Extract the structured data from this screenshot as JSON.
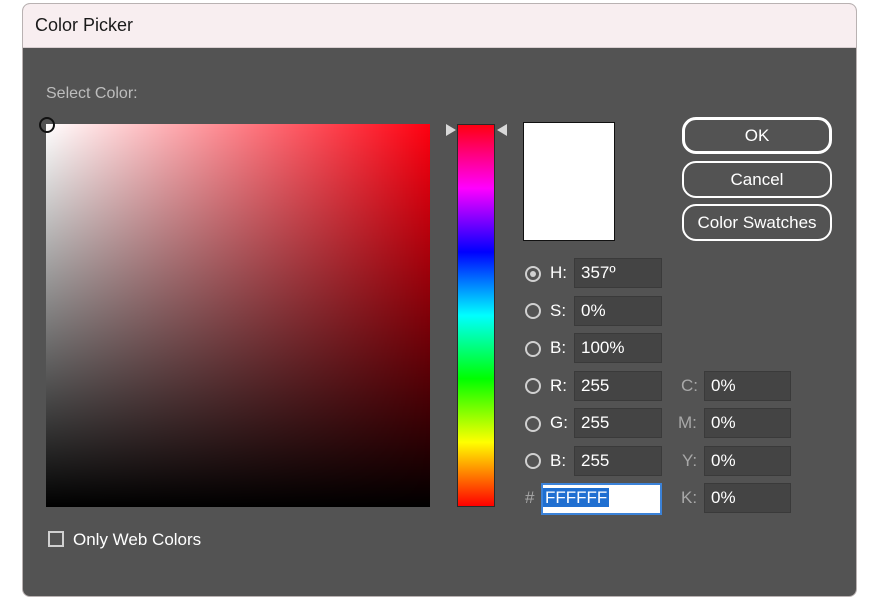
{
  "window": {
    "title": "Color Picker"
  },
  "picker": {
    "select_label": "Select Color:",
    "current_color": "#FFFFFF",
    "hue_color": "#FF0010"
  },
  "buttons": {
    "ok": "OK",
    "cancel": "Cancel",
    "swatches": "Color Swatches"
  },
  "hsb": [
    {
      "key": "H",
      "label": "H:",
      "value": "357º",
      "selected": true
    },
    {
      "key": "S",
      "label": "S:",
      "value": "0%",
      "selected": false
    },
    {
      "key": "B",
      "label": "B:",
      "value": "100%",
      "selected": false
    }
  ],
  "rgb": [
    {
      "key": "R",
      "label": "R:",
      "value": "255",
      "selected": false
    },
    {
      "key": "G",
      "label": "G:",
      "value": "255",
      "selected": false
    },
    {
      "key": "B",
      "label": "B:",
      "value": "255",
      "selected": false
    }
  ],
  "cmyk": [
    {
      "key": "C",
      "label": "C:",
      "value": "0%"
    },
    {
      "key": "M",
      "label": "M:",
      "value": "0%"
    },
    {
      "key": "Y",
      "label": "Y:",
      "value": "0%"
    },
    {
      "key": "K",
      "label": "K:",
      "value": "0%"
    }
  ],
  "hex": {
    "label": "#",
    "value": "FFFFFF"
  },
  "options": {
    "only_web_colors_label": "Only Web Colors",
    "only_web_colors_checked": false
  }
}
